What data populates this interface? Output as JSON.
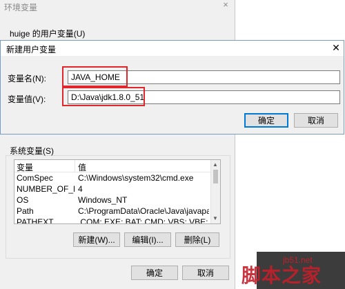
{
  "env_dialog": {
    "title": "环境变量",
    "close_icon": "×",
    "user_group_label": "huige 的用户变量(U)",
    "system_group_label": "系统变量(S)",
    "system_table": {
      "headers": [
        "变量",
        "值"
      ],
      "rows": [
        {
          "name": "ComSpec",
          "value": "C:\\Windows\\system32\\cmd.exe"
        },
        {
          "name": "NUMBER_OF_PR...",
          "value": "4"
        },
        {
          "name": "OS",
          "value": "Windows_NT"
        },
        {
          "name": "Path",
          "value": "C:\\ProgramData\\Oracle\\Java\\javapath;C..."
        },
        {
          "name": "PATHEXT",
          "value": ".COM;.EXE;.BAT;.CMD;.VBS;.VBE;.JS;.JSE;..."
        }
      ]
    },
    "buttons": {
      "new": "新建(W)...",
      "edit": "编辑(I)...",
      "delete": "删除(L)",
      "ok": "确定",
      "cancel": "取消"
    }
  },
  "new_var_dialog": {
    "title": "新建用户变量",
    "close_icon": "✕",
    "name_label": "变量名(N):",
    "value_label": "变量值(V):",
    "name_value": "JAVA_HOME",
    "value_value": "D:\\Java\\jdk1.8.0_51",
    "ok": "确定",
    "cancel": "取消"
  },
  "watermark": {
    "url": "jb51.net",
    "text": "脚本之家"
  },
  "colors": {
    "highlight": "#e0262a",
    "accent": "#0078d7"
  }
}
